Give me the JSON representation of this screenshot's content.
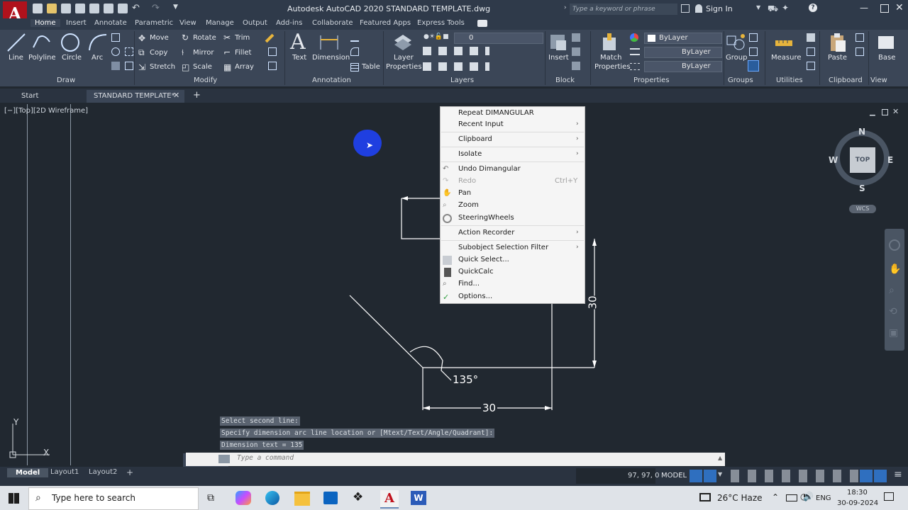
{
  "app": {
    "logo_letter": "A",
    "title": "Autodesk AutoCAD 2020   STANDARD TEMPLATE.dwg",
    "search_placeholder": "Type a keyword or phrase",
    "sign_in": "Sign In"
  },
  "ribbon_tabs": [
    "Home",
    "Insert",
    "Annotate",
    "Parametric",
    "View",
    "Manage",
    "Output",
    "Add-ins",
    "Collaborate",
    "Featured Apps",
    "Express Tools"
  ],
  "ribbon": {
    "draw": {
      "title": "Draw",
      "line": "Line",
      "polyline": "Polyline",
      "circle": "Circle",
      "arc": "Arc"
    },
    "modify": {
      "title": "Modify",
      "move": "Move",
      "rotate": "Rotate",
      "trim": "Trim",
      "copy": "Copy",
      "mirror": "Mirror",
      "fillet": "Fillet",
      "stretch": "Stretch",
      "scale": "Scale",
      "array": "Array"
    },
    "annotation": {
      "title": "Annotation",
      "text": "Text",
      "dimension": "Dimension",
      "table": "Table"
    },
    "layers": {
      "title": "Layers",
      "layer_properties_1": "Layer",
      "layer_properties_2": "Properties",
      "layer_value": "0"
    },
    "block": {
      "title": "Block",
      "insert": "Insert"
    },
    "properties": {
      "title": "Properties",
      "match_1": "Match",
      "match_2": "Properties",
      "color": "ByLayer",
      "linetype": "ByLayer",
      "lineweight": "ByLayer"
    },
    "groups": {
      "title": "Groups",
      "group": "Group"
    },
    "utilities": {
      "title": "Utilities",
      "measure": "Measure"
    },
    "clipboard": {
      "title": "Clipboard",
      "paste": "Paste"
    },
    "view": {
      "title": "View",
      "base": "Base"
    }
  },
  "file_tabs": {
    "start": "Start",
    "current": "STANDARD TEMPLATE*"
  },
  "viewport": {
    "label": "[−][Top][2D Wireframe]"
  },
  "viewcube": {
    "n": "N",
    "s": "S",
    "e": "E",
    "w": "W",
    "top": "TOP",
    "wcs": "WCS"
  },
  "drawing": {
    "dim_angle": "135°",
    "dim_vertical": "30",
    "dim_horizontal": "30"
  },
  "ucs": {
    "y": "Y",
    "x": "X"
  },
  "context_menu": {
    "repeat": "Repeat DIMANGULAR",
    "recent_input": "Recent Input",
    "clipboard": "Clipboard",
    "isolate": "Isolate",
    "undo": "Undo Dimangular",
    "redo": "Redo",
    "redo_shortcut": "Ctrl+Y",
    "pan": "Pan",
    "zoom": "Zoom",
    "steering": "SteeringWheels",
    "action_recorder": "Action Recorder",
    "subobject": "Subobject Selection Filter",
    "quick_select": "Quick Select...",
    "quickcalc": "QuickCalc",
    "find": "Find...",
    "options": "Options..."
  },
  "command": {
    "history": [
      "Select second line:",
      "Specify dimension arc line location or [Mtext/Text/Angle/Quadrant]:",
      "Dimension text = 135"
    ],
    "placeholder": "Type a command"
  },
  "status": {
    "layout_tabs": [
      "Model",
      "Layout1",
      "Layout2"
    ],
    "coords": "97, 97, 0",
    "mode": "MODEL"
  },
  "taskbar": {
    "search_placeholder": "Type here to search",
    "weather": "26°C  Haze",
    "lang": "ENG",
    "time": "18:30",
    "date": "30-09-2024"
  }
}
